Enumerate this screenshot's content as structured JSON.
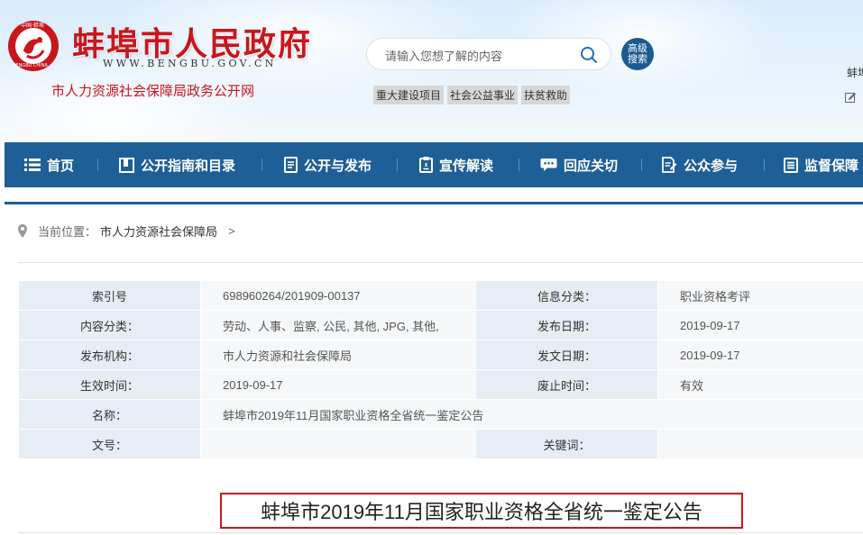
{
  "header": {
    "emblem_text_top": "中国·蚌埠",
    "emblem_text_bottom": "BENGBU CHINA",
    "site_title": "蚌埠市人民政府",
    "site_url": "WWW.BENGBU.GOV.CN",
    "site_subtitle": "市人力资源社会保障局政务公开网",
    "search": {
      "placeholder": "请输入您想了解的内容"
    },
    "advanced_search_label": "高级\n搜索",
    "tags": [
      "重大建设项目",
      "社会公益事业",
      "扶贫救助"
    ],
    "right_text": "蚌埠",
    "colors": {
      "brand_red": "#c8161d",
      "nav_blue": "#1e5f98",
      "adv_search_bg": "#1c5b92"
    }
  },
  "nav": {
    "items": [
      {
        "label": "首页",
        "icon": "list-icon"
      },
      {
        "label": "公开指南和目录",
        "icon": "book-icon"
      },
      {
        "label": "公开与发布",
        "icon": "document-icon"
      },
      {
        "label": "宣传解读",
        "icon": "clipboard-icon"
      },
      {
        "label": "回应关切",
        "icon": "chat-icon"
      },
      {
        "label": "公众参与",
        "icon": "edit-doc-icon"
      },
      {
        "label": "监督保障",
        "icon": "list-box-icon"
      }
    ]
  },
  "breadcrumb": {
    "prefix": "当前位置：",
    "crumb": "市人力资源社会保障局",
    "arrow": ">"
  },
  "info": {
    "rows": [
      {
        "l1": "索引号",
        "v1": "698960264/201909-00137",
        "l2": "信息分类：",
        "v2": "职业资格考评"
      },
      {
        "l1": "内容分类：",
        "v1": "劳动、人事、监察, 公民, 其他, JPG, 其他,",
        "l2": "发布日期：",
        "v2": "2019-09-17"
      },
      {
        "l1": "发布机构：",
        "v1": "市人力资源和社会保障局",
        "l2": "发文日期：",
        "v2": "2019-09-17"
      },
      {
        "l1": "生效时间：",
        "v1": "2019-09-17",
        "l2": "废止时间：",
        "v2": "有效"
      },
      {
        "l1": "名称：",
        "v1": "蚌埠市2019年11月国家职业资格全省统一鉴定公告"
      },
      {
        "l1": "文号：",
        "v1": "",
        "l2": "关键词：",
        "v2": ""
      }
    ]
  },
  "article": {
    "title": "蚌埠市2019年11月国家职业资格全省统一鉴定公告"
  }
}
